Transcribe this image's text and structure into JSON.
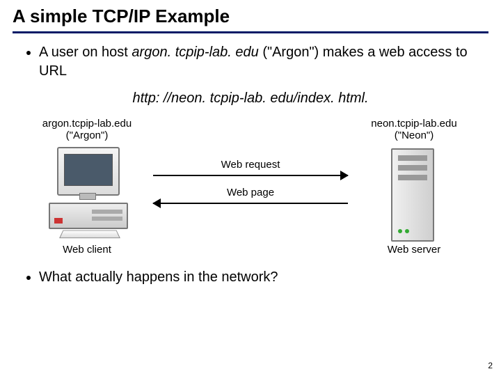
{
  "title": "A simple TCP/IP Example",
  "bullet1": {
    "pre": "A user on host ",
    "host": "argon. tcpip-lab. edu",
    "post": " (\"Argon\") makes a web access to URL"
  },
  "url": "http: //neon. tcpip-lab. edu/index. html.",
  "diagram": {
    "left_host_line1": "argon.tcpip-lab.edu",
    "left_host_line2": "(\"Argon\")",
    "right_host_line1": "neon.tcpip-lab.edu",
    "right_host_line2": "(\"Neon\")",
    "arrow_request": "Web request",
    "arrow_response": "Web page",
    "left_role": "Web client",
    "right_role": "Web server"
  },
  "bullet2": "What actually happens in the network?",
  "page_number": "2"
}
